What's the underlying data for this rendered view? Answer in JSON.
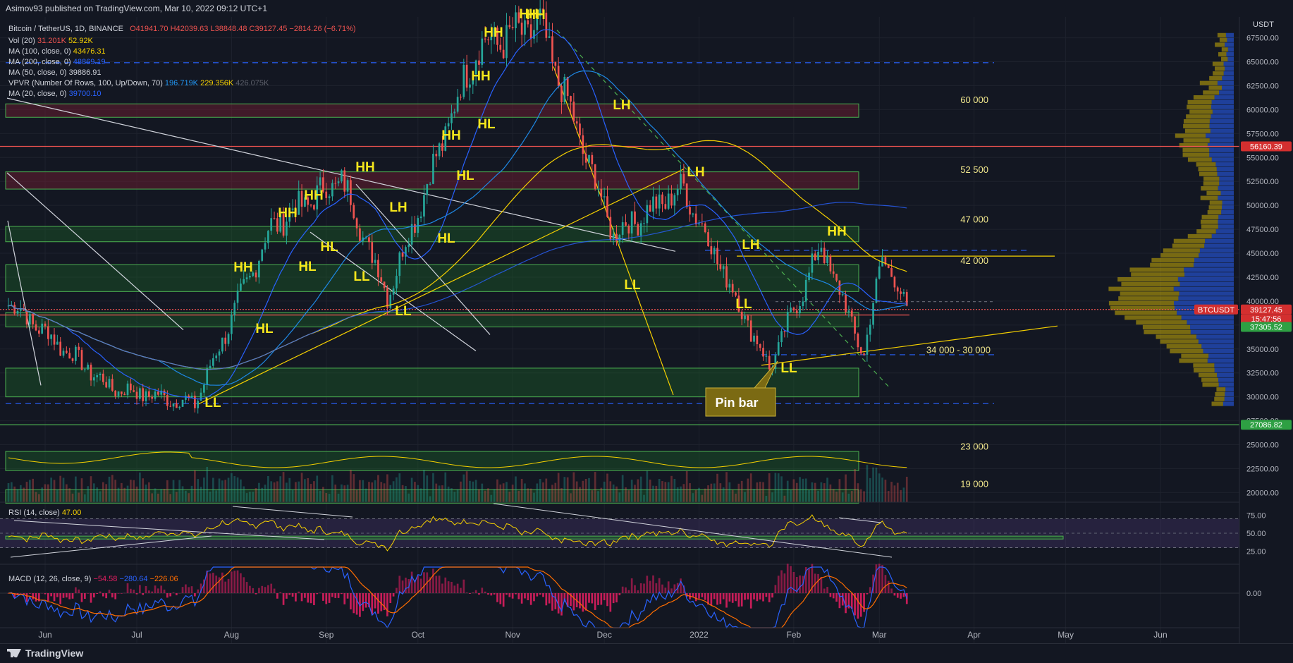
{
  "header": {
    "published": "Asimov93 published on TradingView.com, Mar 10, 2022 09:12 UTC+1"
  },
  "legend": {
    "symbol": "Bitcoin / TetherUS, 1D, BINANCE",
    "ohlc": "O41941.70  H42039.63  L38848.48  C39127.45  −2814.26 (−6.71%)",
    "vol": "Vol (20)",
    "vol_v1": "31.201K",
    "vol_v2": "52.92K",
    "ma100": "MA (100, close, 0)",
    "ma100_v": "43476.31",
    "ma200": "MA (200, close, 0)",
    "ma200_v": "48869.19",
    "ma50": "MA (50, close, 0)",
    "ma50_v": "39886.91",
    "vpvr": "VPVR (Number Of Rows, 100, Up/Down, 70)",
    "vpvr_v1": "196.719K",
    "vpvr_v2": "229.356K",
    "vpvr_v3": "426.075K",
    "ma20": "MA (20, close, 0)",
    "ma20_v": "39700.10",
    "rsi": "RSI (14, close)",
    "rsi_v": "47.00",
    "macd": "MACD (12, 26, close, 9)",
    "macd_v1": "−54.58",
    "macd_v2": "−280.64",
    "macd_v3": "−226.06"
  },
  "axis": {
    "currency": "USDT",
    "price_ticks": [
      "67500.00",
      "65000.00",
      "62500.00",
      "60000.00",
      "57500.00",
      "55000.00",
      "52500.00",
      "50000.00",
      "47500.00",
      "45000.00",
      "42500.00",
      "40000.00",
      "37500.00",
      "35000.00",
      "32500.00",
      "30000.00",
      "27500.00",
      "25000.00",
      "22500.00",
      "20000.00"
    ],
    "rsi_ticks": [
      "75.00",
      "50.00",
      "25.00"
    ],
    "macd_ticks": [
      "0.00"
    ],
    "time_labels": [
      "Jun",
      "Jul",
      "Aug",
      "Sep",
      "Oct",
      "Nov",
      "Dec",
      "2022",
      "Feb",
      "Mar",
      "Apr",
      "May",
      "Jun"
    ]
  },
  "price_tags": {
    "resistance": "56160.39",
    "current_symbol": "BTCUSDT",
    "current_price": "39127.45",
    "countdown": "15:47:56",
    "support": "37305.52",
    "low": "27086.82"
  },
  "levels": {
    "z60": "60 000",
    "z52": "52 500",
    "z47": "47 000",
    "z42": "42 000",
    "z34": "34 000 - 30 000",
    "z23": "23 000",
    "z19": "19 000"
  },
  "annotations": {
    "pin_bar": "Pin bar",
    "marks": [
      "HH",
      "HH",
      "HH",
      "HH",
      "HH",
      "HH",
      "HH",
      "HH",
      "HH",
      "HH",
      "HL",
      "HL",
      "HL",
      "HL",
      "HL",
      "HL",
      "HL",
      "LH",
      "LH",
      "LH",
      "LH",
      "LL",
      "LL",
      "LL",
      "LL",
      "LL",
      "LL"
    ]
  },
  "colors": {
    "bg": "#131722",
    "up": "#26a69a",
    "down": "#ef5350",
    "grid": "#1e222d",
    "zone_green": "#1b5e20",
    "zone_red": "#5d1a24",
    "ma_blue": "#2962ff",
    "ma_yellow": "#f5d000",
    "annot": "#f5e61c"
  },
  "footer": {
    "brand": "TradingView"
  },
  "chart_data": {
    "type": "candlestick",
    "symbol": "BTCUSDT",
    "timeframe": "1D",
    "x_range": [
      "2021-05",
      "2022-06"
    ],
    "ylim": [
      19000,
      68500
    ],
    "last_close": 39127.45,
    "anchors": [
      {
        "date": "2021-05-20",
        "price": 40000
      },
      {
        "date": "2021-06-22",
        "price": 31000
      },
      {
        "date": "2021-07-20",
        "price": 29300
      },
      {
        "date": "2021-08-14",
        "price": 47800
      },
      {
        "date": "2021-09-06",
        "price": 52800
      },
      {
        "date": "2021-09-21",
        "price": 40600
      },
      {
        "date": "2021-10-20",
        "price": 66500
      },
      {
        "date": "2021-11-10",
        "price": 68700
      },
      {
        "date": "2021-12-04",
        "price": 47000
      },
      {
        "date": "2021-12-27",
        "price": 51800
      },
      {
        "date": "2022-01-24",
        "price": 33000
      },
      {
        "date": "2022-02-10",
        "price": 45800
      },
      {
        "date": "2022-02-24",
        "price": 34300
      },
      {
        "date": "2022-03-02",
        "price": 45000
      },
      {
        "date": "2022-03-10",
        "price": 39127
      }
    ],
    "rsi_last": 47.0,
    "macd_last": [
      -54.58,
      -280.64,
      -226.06
    ]
  }
}
